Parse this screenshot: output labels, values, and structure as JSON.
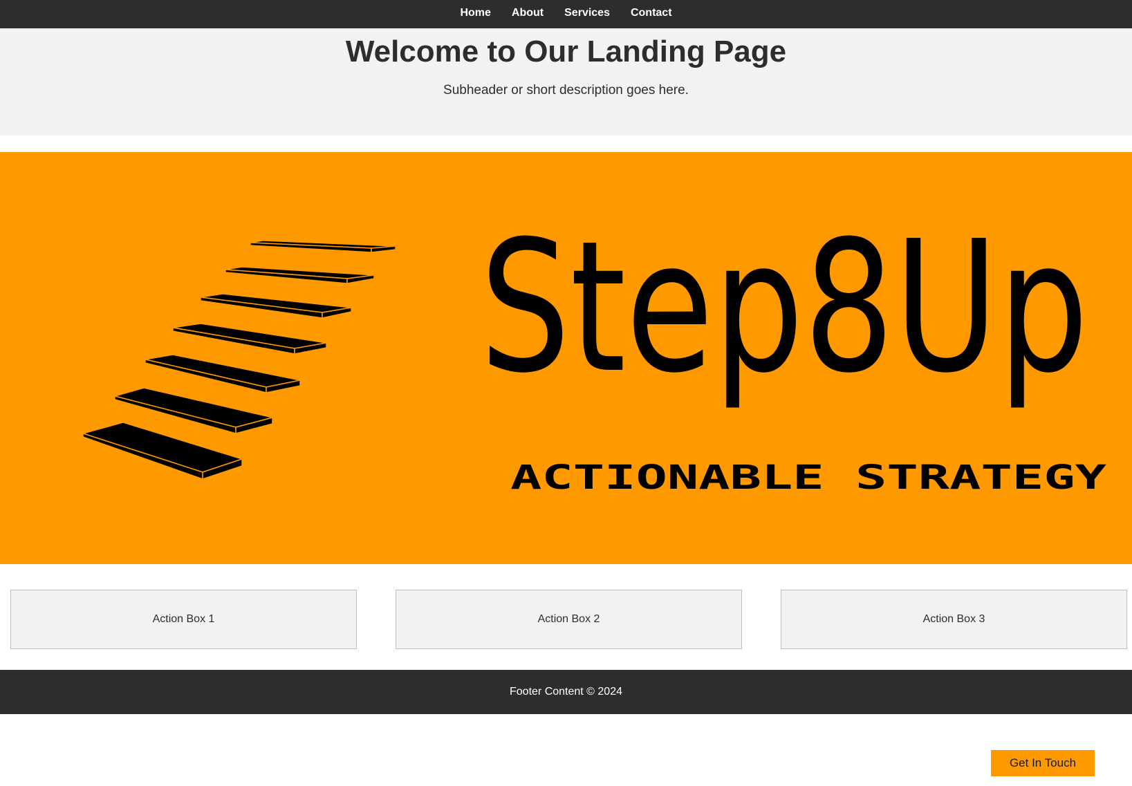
{
  "nav": {
    "items": [
      {
        "label": "Home"
      },
      {
        "label": "About"
      },
      {
        "label": "Services"
      },
      {
        "label": "Contact"
      }
    ]
  },
  "header": {
    "title": "Welcome to Our Landing Page",
    "subtitle": "Subheader or short description goes here."
  },
  "hero": {
    "logo_text": "Step8Up",
    "tagline": "ACTIONABLE STRATEGY",
    "colors": {
      "background": "#ff9900",
      "ink": "#000000"
    }
  },
  "action_boxes": [
    {
      "label": "Action Box 1"
    },
    {
      "label": "Action Box 2"
    },
    {
      "label": "Action Box 3"
    }
  ],
  "footer": {
    "text": "Footer Content © 2024"
  },
  "cta": {
    "label": "Get In Touch"
  },
  "colors": {
    "accent": "#ff9900",
    "dark": "#2d2d2d",
    "light": "#f2f2f2"
  }
}
